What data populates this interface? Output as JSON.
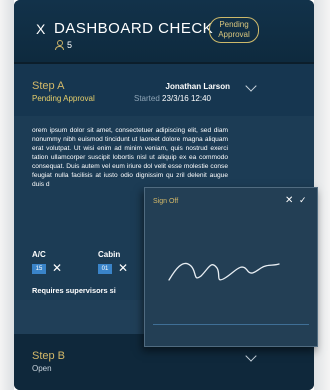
{
  "header": {
    "close_glyph": "X",
    "title": "DASHBOARD CHECK",
    "user_count": "5",
    "status_badge": "Pending\nApproval"
  },
  "step_a": {
    "title": "Step A",
    "status": "Pending Approval",
    "user": "Jonathan Larson",
    "started_label": "Started",
    "started_value": "23/3/16 12:40",
    "body": "orem ipsum dolor sit amet, consectetuer adipiscing elit, sed diam nonummy nibh euismod tincidunt ut laoreet dolore magna aliquam erat volutpat. Ut wisi enim ad minim veniam, quis nostrud exerci tation ullamcorper suscipit lobortis nisl ut aliquip ex ea commodo consequat. Duis autem vel eum iriure dol velit esse molestie conse feugiat nulla facilisis at iusto odio dignissim qu zril delenit augue duis d",
    "fields": [
      {
        "label": "A/C",
        "value": "15"
      },
      {
        "label": "Cabin",
        "value": "01"
      }
    ],
    "requirement_text": "Requires supervisors si"
  },
  "step_b": {
    "title": "Step B",
    "status": "Open"
  },
  "signoff": {
    "title": "Sign Off"
  },
  "colors": {
    "accent": "#d4b969",
    "field_blue": "#3a84c9",
    "background": "#0c1e2b"
  },
  "icons": {
    "close": "close-icon",
    "user": "user-icon",
    "chevron": "chevron-down-icon",
    "confirm": "check-icon"
  }
}
